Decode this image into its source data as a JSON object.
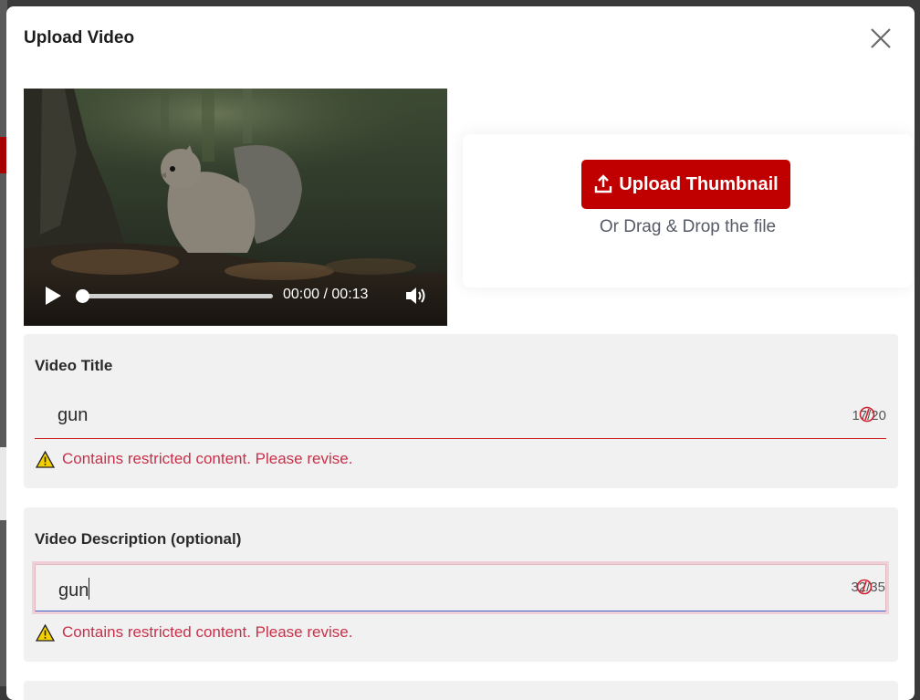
{
  "modal": {
    "title": "Upload Video"
  },
  "video": {
    "current_time": "00:00",
    "separator": "/",
    "duration": "00:13",
    "progress": 0
  },
  "thumbnail": {
    "upload_label": "Upload Thumbnail",
    "drag_text": "Or Drag & Drop the file"
  },
  "title_section": {
    "label": "Video Title",
    "value": "gun",
    "counter": "17/20",
    "error": "Contains restricted content. Please revise."
  },
  "description_section": {
    "label": "Video Description (optional)",
    "value": "gun",
    "counter": "32/35",
    "error": "Contains restricted content. Please revise."
  },
  "colors": {
    "brand_red": "#c00000",
    "error_red": "#c9304a",
    "section_bg": "#f1f1f1"
  },
  "icons": [
    "close-icon",
    "play-icon",
    "volume-icon",
    "upload-icon",
    "warning-icon",
    "error-circle-icon"
  ]
}
